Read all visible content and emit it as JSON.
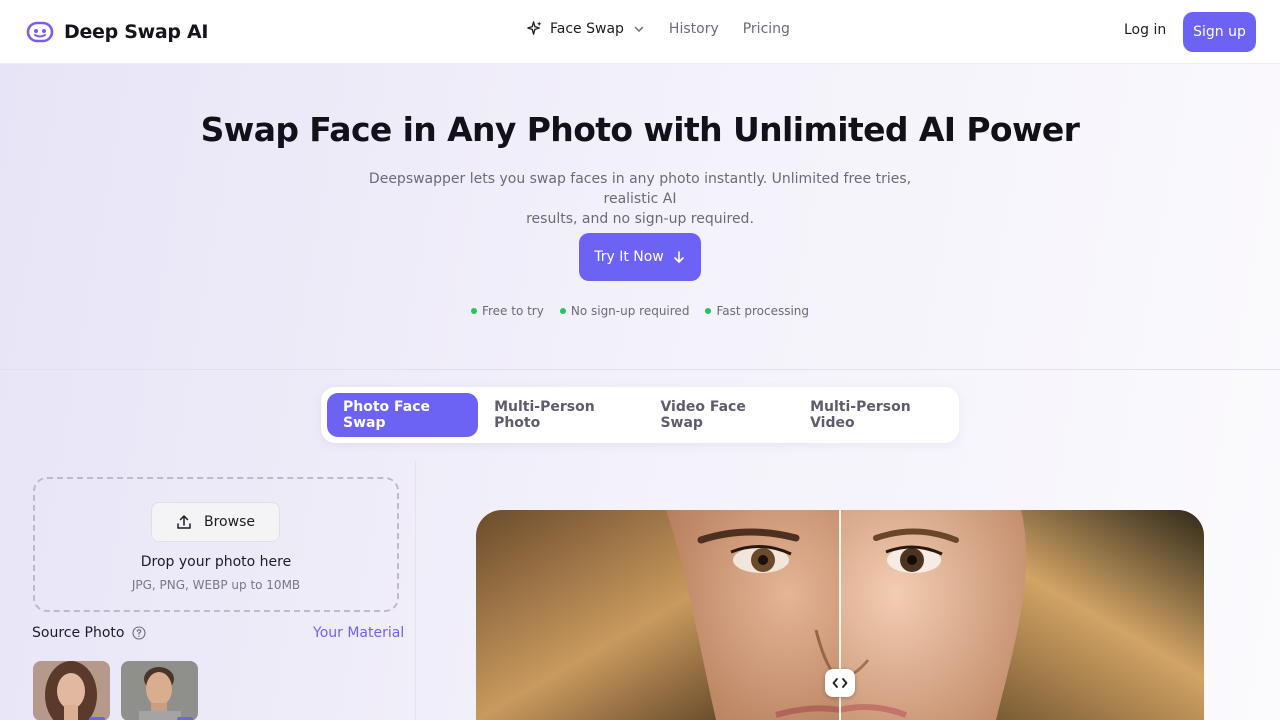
{
  "header": {
    "brand": "Deep Swap AI",
    "nav": [
      {
        "label": "Face Swap",
        "icon": "sparkle-icon",
        "has_dropdown": true
      },
      {
        "label": "History"
      },
      {
        "label": "Pricing"
      }
    ],
    "login": "Log in",
    "signup": "Sign up"
  },
  "hero": {
    "title": "Swap Face in Any Photo with Unlimited AI Power",
    "subtitle_line1": "Deepswapper lets you swap faces in any photo instantly. Unlimited free tries, realistic AI",
    "subtitle_line2": "results, and no sign-up required.",
    "cta": "Try It Now",
    "features": [
      "Free to try",
      "No sign-up required",
      "Fast processing"
    ]
  },
  "tabs": [
    {
      "label": "Photo Face Swap",
      "active": true
    },
    {
      "label": "Multi-Person Photo",
      "active": false
    },
    {
      "label": "Video Face Swap",
      "active": false
    },
    {
      "label": "Multi-Person Video",
      "active": false
    }
  ],
  "upload": {
    "browse": "Browse",
    "drop_title": "Drop your photo here",
    "drop_hint": "JPG, PNG, WEBP up to 10MB"
  },
  "source": {
    "label": "Source Photo",
    "material_link": "Your Material"
  },
  "colors": {
    "accent": "#6c63f5",
    "feature_dot": "#22c55e"
  }
}
